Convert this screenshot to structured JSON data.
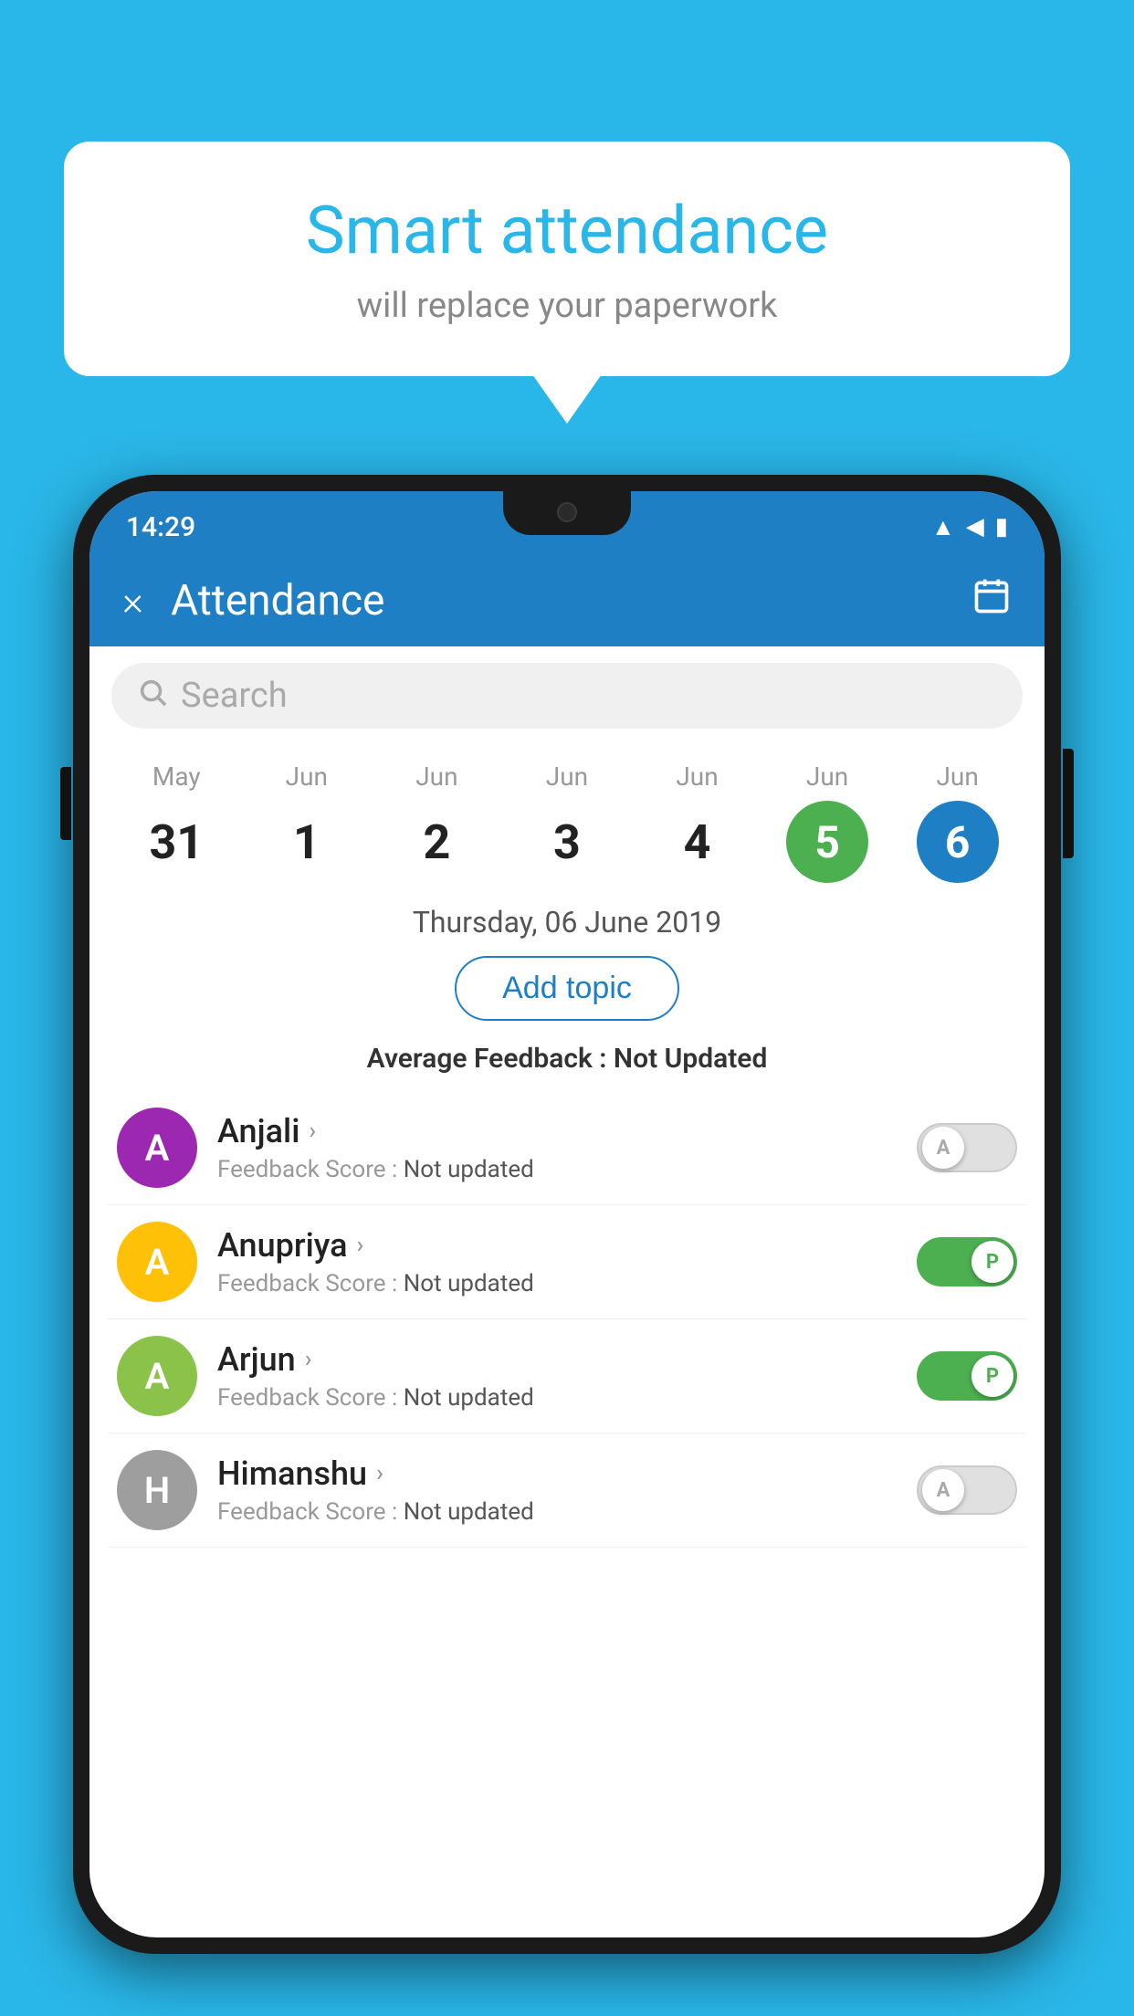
{
  "background_color": "#29B6E8",
  "speech_bubble": {
    "title": "Smart attendance",
    "subtitle": "will replace your paperwork"
  },
  "status_bar": {
    "time": "14:29",
    "wifi_icon": "▲",
    "signal_icon": "◀",
    "battery_icon": "▮"
  },
  "header": {
    "title": "Attendance",
    "close_label": "×",
    "calendar_icon": "📅"
  },
  "search": {
    "placeholder": "Search"
  },
  "calendar": {
    "days": [
      {
        "month": "May",
        "date": "31",
        "state": "normal"
      },
      {
        "month": "Jun",
        "date": "1",
        "state": "normal"
      },
      {
        "month": "Jun",
        "date": "2",
        "state": "normal"
      },
      {
        "month": "Jun",
        "date": "3",
        "state": "normal"
      },
      {
        "month": "Jun",
        "date": "4",
        "state": "normal"
      },
      {
        "month": "Jun",
        "date": "5",
        "state": "today"
      },
      {
        "month": "Jun",
        "date": "6",
        "state": "selected"
      }
    ],
    "selected_label": "Thursday, 06 June 2019"
  },
  "add_topic_label": "Add topic",
  "avg_feedback_label": "Average Feedback :",
  "avg_feedback_value": "Not Updated",
  "students": [
    {
      "name": "Anjali",
      "avatar_letter": "A",
      "avatar_color": "#9C27B0",
      "feedback_label": "Feedback Score :",
      "feedback_value": "Not updated",
      "toggle_state": "off",
      "toggle_letter": "A"
    },
    {
      "name": "Anupriya",
      "avatar_letter": "A",
      "avatar_color": "#FFC107",
      "feedback_label": "Feedback Score :",
      "feedback_value": "Not updated",
      "toggle_state": "on",
      "toggle_letter": "P"
    },
    {
      "name": "Arjun",
      "avatar_letter": "A",
      "avatar_color": "#8BC34A",
      "feedback_label": "Feedback Score :",
      "feedback_value": "Not updated",
      "toggle_state": "on",
      "toggle_letter": "P"
    },
    {
      "name": "Himanshu",
      "avatar_letter": "H",
      "avatar_color": "#9E9E9E",
      "feedback_label": "Feedback Score :",
      "feedback_value": "Not updated",
      "toggle_state": "off",
      "toggle_letter": "A"
    }
  ]
}
